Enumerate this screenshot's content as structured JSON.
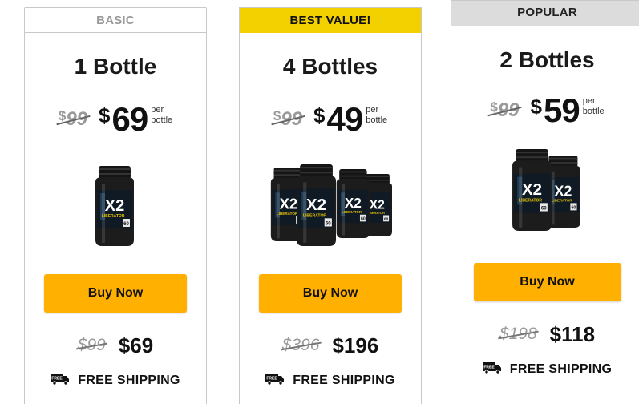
{
  "colors": {
    "best_value_banner": "#f3d100",
    "popular_banner": "#dcdcdc",
    "buy_button": "#ffb000"
  },
  "plans": [
    {
      "banner": "BASIC",
      "title": "1 Bottle",
      "old_price": "99",
      "old_currency": "$",
      "currency": "$",
      "price": "69",
      "per_line1": "per",
      "per_line2": "bottle",
      "bottles": 1,
      "buy_label": "Buy Now",
      "total_old": "$99",
      "total_new": "$69",
      "truck_label": "FREE",
      "shipping": "FREE SHIPPING"
    },
    {
      "banner": "BEST VALUE!",
      "title": "4 Bottles",
      "old_price": "99",
      "old_currency": "$",
      "currency": "$",
      "price": "49",
      "per_line1": "per",
      "per_line2": "bottle",
      "bottles": 4,
      "buy_label": "Buy Now",
      "total_old": "$396",
      "total_new": "$196",
      "truck_label": "FREE",
      "shipping": "FREE SHIPPING"
    },
    {
      "banner": "POPULAR",
      "title": "2 Bottles",
      "old_price": "99",
      "old_currency": "$",
      "currency": "$",
      "price": "59",
      "per_line1": "per",
      "per_line2": "bottle",
      "bottles": 2,
      "buy_label": "Buy Now",
      "total_old": "$198",
      "total_new": "$118",
      "truck_label": "FREE",
      "shipping": "FREE SHIPPING"
    }
  ],
  "product": {
    "label_line1": "X2",
    "label_line2": "LIBERATOR",
    "label_count": "60"
  }
}
